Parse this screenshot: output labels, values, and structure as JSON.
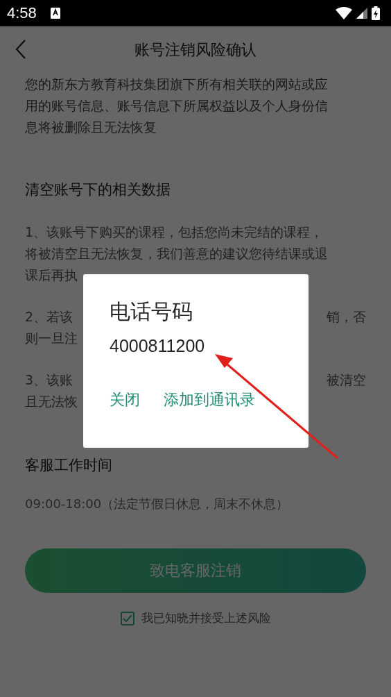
{
  "status_bar": {
    "time": "4:58"
  },
  "nav": {
    "title": "账号注销风险确认"
  },
  "intro": [
    "您的新东方教育科技集团旗下所有相关联的网站或应",
    "用的账号信息、账号信息下所属权益以及个人身份信",
    "息将被删除且无法恢复"
  ],
  "data_section": {
    "heading": "清空账号下的相关数据",
    "paragraphs": [
      [
        {
          "left": "1、该账号下购买的课程，包括您尚未完结的课程，"
        },
        {
          "left": "将被清空且无法恢复，我们善意的建议您待结课或退"
        },
        {
          "left": "课后再执"
        }
      ],
      [
        {
          "left": "2、若该",
          "right": "销，否"
        },
        {
          "left": "则一旦注"
        }
      ],
      [
        {
          "left": "3、该账",
          "right": "被清空"
        },
        {
          "left": "且无法恢"
        }
      ]
    ]
  },
  "service": {
    "heading": "客服工作时间",
    "hours": "09:00-18:00（法定节假日休息，周末不休息）"
  },
  "call_button": {
    "label": "致电客服注销"
  },
  "agreement": {
    "label": "我已知晓并接受上述风险",
    "checked": true
  },
  "dialog": {
    "title": "电话号码",
    "number": "4000811200",
    "buttons": [
      "关闭",
      "添加到通讯录"
    ]
  }
}
